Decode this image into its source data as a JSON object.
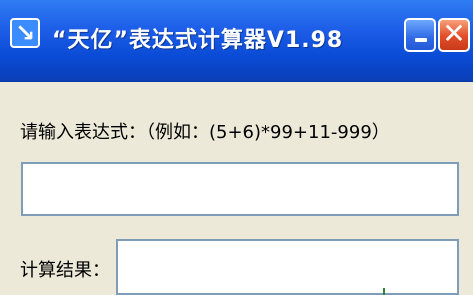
{
  "window": {
    "title": "“天亿”表达式计算器V1.98",
    "app_icon": "arrow-down-right-icon",
    "minimize_icon": "minimize-icon",
    "close_icon": "close-icon",
    "titlebar_color": "#0a4bd6",
    "close_color": "#e24d28"
  },
  "form": {
    "prompt": "请输入表达式：（例如：(5+6)*99+11-999）",
    "expression_value": "",
    "result_label": "计算结果：",
    "result_value": ""
  }
}
